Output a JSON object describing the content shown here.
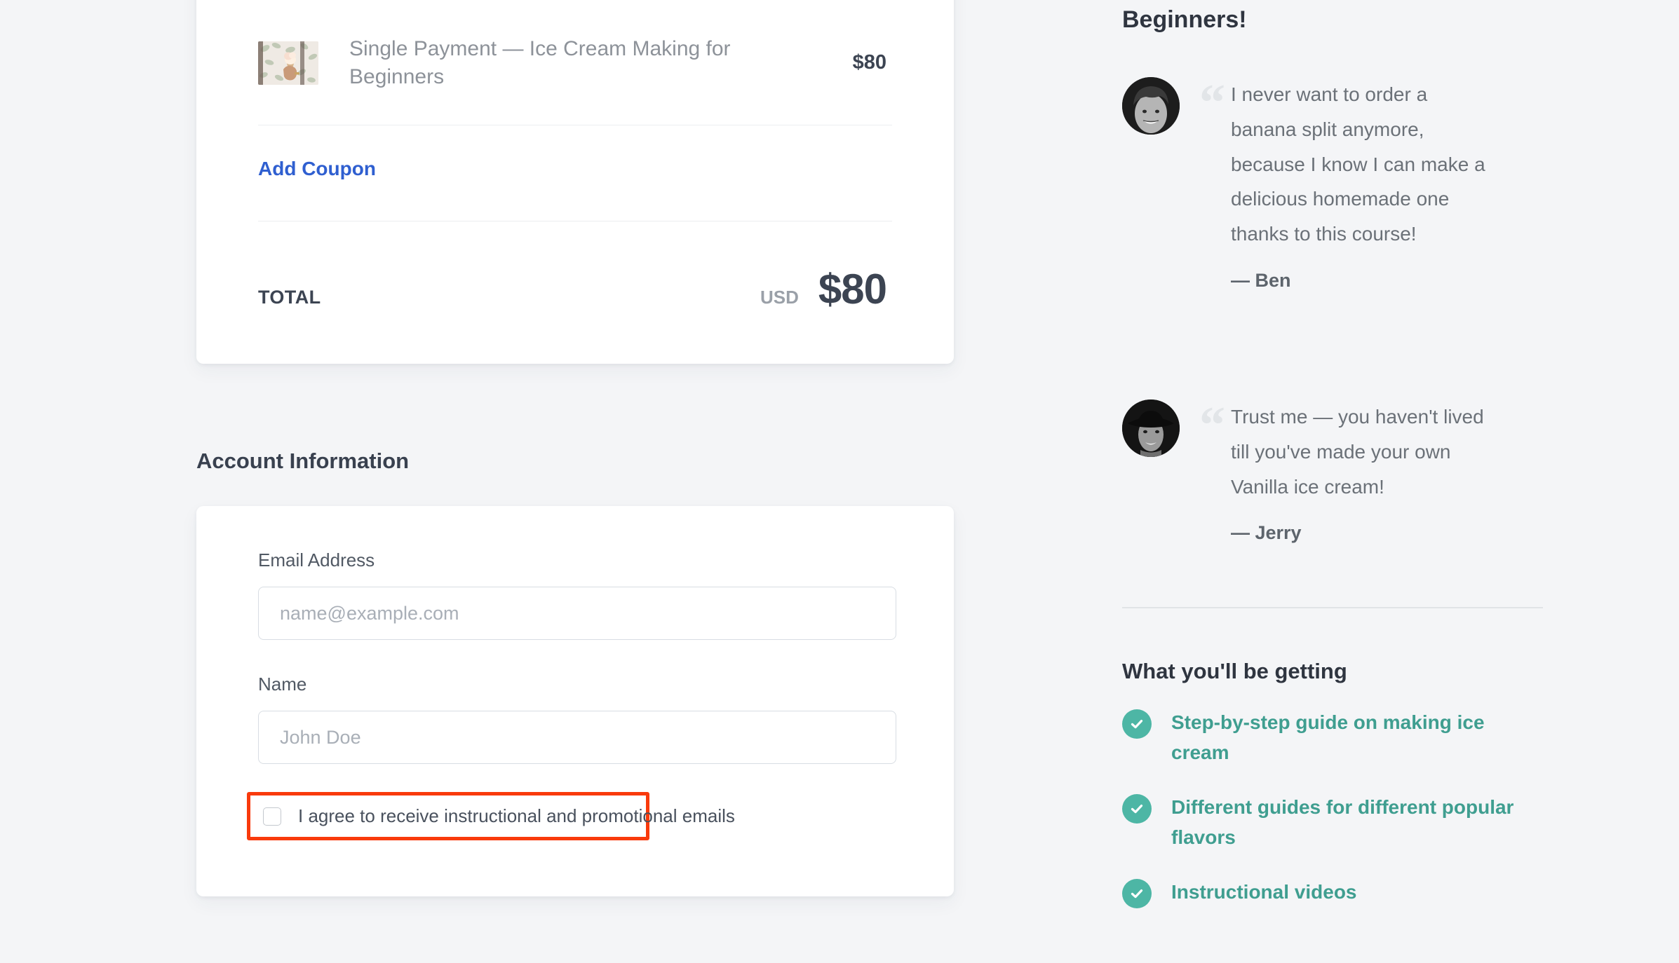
{
  "order": {
    "item": {
      "title": "Single Payment — Ice Cream Making for Beginners",
      "price": "$80",
      "thumbnail_alt": "ice-cream-cone-photo"
    },
    "coupon_label": "Add Coupon",
    "total_label": "TOTAL",
    "currency": "USD",
    "total_amount": "$80"
  },
  "account": {
    "section_title": "Account Information",
    "email_label": "Email Address",
    "email_placeholder": "name@example.com",
    "email_value": "",
    "name_label": "Name",
    "name_placeholder": "John Doe",
    "name_value": "",
    "consent_label": "I agree to receive instructional and promotional emails",
    "consent_checked": false
  },
  "sidebar": {
    "promo_heading": "about Ice Cream Making for Beginners!",
    "testimonials": [
      {
        "quote_mark": "“",
        "text": "I never want to order a banana split anymore, because I know I can make a delicious homemade one thanks to this course!",
        "author": "— Ben",
        "avatar_alt": "smiling-man-portrait"
      },
      {
        "quote_mark": "“",
        "text": "Trust me — you haven't lived till you've made your own Vanilla ice cream!",
        "author": "— Jerry",
        "avatar_alt": "man-with-hat-portrait"
      }
    ],
    "benefits_heading": "What you'll be getting",
    "benefits": [
      "Step-by-step guide on making ice cream",
      "Different guides for different popular flavors",
      "Instructional videos"
    ]
  },
  "colors": {
    "page_background": "#f4f5f7",
    "card_background": "#ffffff",
    "link_blue": "#2f5fd0",
    "accent_teal": "#4db6a5",
    "benefit_text_teal": "#3f9e90",
    "highlight_red": "#f93a0c",
    "text_dark": "#3c4452",
    "text_muted": "#8d9299"
  }
}
